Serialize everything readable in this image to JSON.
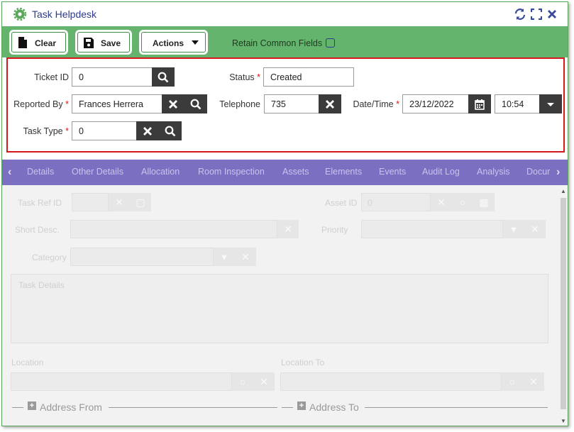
{
  "window": {
    "title": "Task Helpdesk"
  },
  "toolbar": {
    "clear_label": "Clear",
    "save_label": "Save",
    "actions_label": "Actions",
    "retain_label": "Retain Common Fields",
    "retain_checked": false
  },
  "form": {
    "ticket_id": {
      "label": "Ticket ID",
      "value": "0"
    },
    "status": {
      "label": "Status",
      "value": "Created"
    },
    "reported_by": {
      "label": "Reported By",
      "value": "Frances Herrera"
    },
    "telephone": {
      "label": "Telephone",
      "value": "735"
    },
    "datetime": {
      "label": "Date/Time",
      "date": "23/12/2022",
      "time": "10:54"
    },
    "task_type": {
      "label": "Task Type",
      "value": "0"
    },
    "required_marker": "*"
  },
  "tabs": [
    "Details",
    "Other Details",
    "Allocation",
    "Room Inspection",
    "Assets",
    "Elements",
    "Events",
    "Audit Log",
    "Analysis",
    "Docur"
  ],
  "details": {
    "task_ref_label": "Task Ref ID",
    "asset_id_label": "Asset ID",
    "asset_id_value": "0",
    "short_desc_label": "Short Desc.",
    "priority_label": "Priority",
    "category_label": "Category",
    "task_details_placeholder": "Task Details",
    "location_label": "Location",
    "location_to_label": "Location To",
    "address_from_label": "Address From",
    "address_to_label": "Address To"
  },
  "colors": {
    "toolbar_green": "#64b46e",
    "tab_purple": "#7b6fc1",
    "highlight_red": "#d7191c",
    "title_blue": "#2b3a8f"
  }
}
